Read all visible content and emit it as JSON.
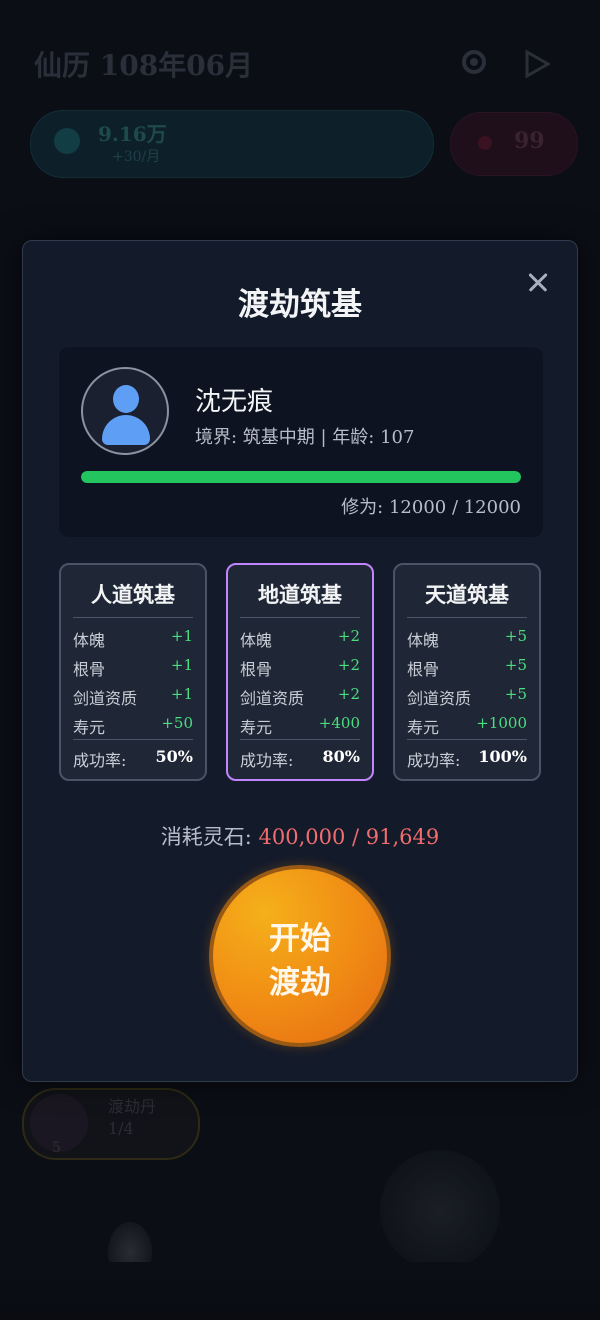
{
  "background": {
    "calendar": "仙历 108年06月",
    "spirit_stones_value": "9.16万",
    "spirit_stones_rate": "+30/月",
    "hearts_value": "99",
    "skill_line1": "渡劫丹",
    "skill_line2": "1/4",
    "skill_count": "5"
  },
  "modal": {
    "title": "渡劫筑基",
    "character": {
      "name": "沈无痕",
      "info": "境界: 筑基中期 | 年龄: 107",
      "cultivation_text": "修为: 12000 / 12000",
      "cultivation_progress": 1.0
    },
    "paths": [
      {
        "name": "人道筑基",
        "stats": [
          {
            "label": "体魄",
            "value": "+1"
          },
          {
            "label": "根骨",
            "value": "+1"
          },
          {
            "label": "剑道资质",
            "value": "+1"
          },
          {
            "label": "寿元",
            "value": "+50"
          }
        ],
        "rate_label": "成功率:",
        "rate_value": "50%",
        "selected": false
      },
      {
        "name": "地道筑基",
        "stats": [
          {
            "label": "体魄",
            "value": "+2"
          },
          {
            "label": "根骨",
            "value": "+2"
          },
          {
            "label": "剑道资质",
            "value": "+2"
          },
          {
            "label": "寿元",
            "value": "+400"
          }
        ],
        "rate_label": "成功率:",
        "rate_value": "80%",
        "selected": true
      },
      {
        "name": "天道筑基",
        "stats": [
          {
            "label": "体魄",
            "value": "+5"
          },
          {
            "label": "根骨",
            "value": "+5"
          },
          {
            "label": "剑道资质",
            "value": "+5"
          },
          {
            "label": "寿元",
            "value": "+1000"
          }
        ],
        "rate_label": "成功率:",
        "rate_value": "100%",
        "selected": false
      }
    ],
    "cost_label": "消耗灵石:",
    "cost_value": "400,000 / 91,649",
    "start_line1": "开始",
    "start_line2": "渡劫"
  },
  "colors": {
    "accent_green": "#22c55e",
    "selected_border": "#c084fc",
    "cost_red": "#f26d6d",
    "button_orange": "#f08a14"
  }
}
